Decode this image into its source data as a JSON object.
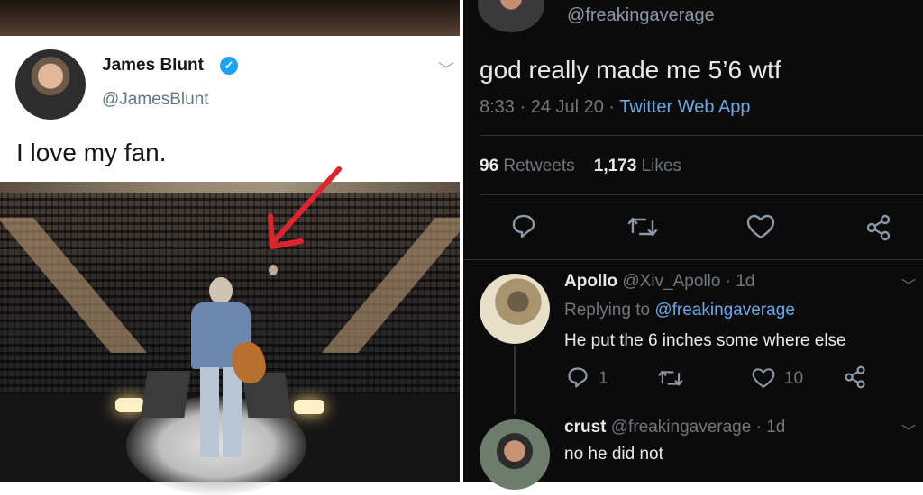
{
  "left_tweet": {
    "name": "James Blunt",
    "handle": "@JamesBlunt",
    "text": "I love my fan.",
    "verified_icon": "check-badge-icon",
    "menu_icon": "chevron-down-icon"
  },
  "right_tweet": {
    "handle": "@freakingaverage",
    "text": "god really made me 5’6 wtf",
    "meta_time": "8:33 · 24 Jul 20 · ",
    "meta_source": "Twitter Web App",
    "retweets_count": "96",
    "retweets_label": "Retweets",
    "likes_count": "1,173",
    "likes_label": "Likes",
    "actions": [
      "comment-icon",
      "retweet-icon",
      "heart-icon",
      "share-icon"
    ]
  },
  "replies": [
    {
      "name": "Apollo",
      "handle": "@Xiv_Apollo · 1d",
      "replying_to_label": "Replying to ",
      "replying_to_handle": "@freakingaverage",
      "text": "He put the 6 inches some where else",
      "reply_count": "1",
      "like_count": "10"
    },
    {
      "name": "crust",
      "handle": "@freakingaverage · 1d",
      "text": "no he did not"
    }
  ],
  "colors": {
    "verified_blue": "#1da1f2",
    "link_blue": "#6aa9e6",
    "arrow_red": "#e0242f",
    "dark_bg": "#0b0b0c"
  }
}
